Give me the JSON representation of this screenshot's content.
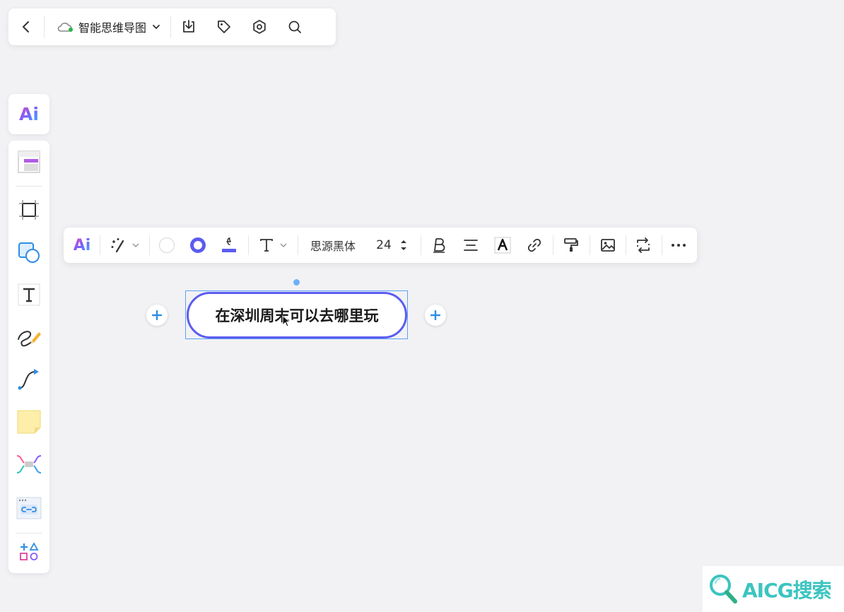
{
  "topbar": {
    "title": "智能思维导图",
    "icons": [
      "back-icon",
      "cloud-sync-icon",
      "chevron-down-icon",
      "download-icon",
      "tag-icon",
      "settings-icon",
      "search-icon"
    ]
  },
  "sidebar": {
    "ai_label": "Ai",
    "tools": [
      "template-icon",
      "frame-icon",
      "shape-icon",
      "text-tool-icon",
      "pen-icon",
      "connector-icon",
      "sticky-note-icon",
      "mindmap-icon",
      "link-card-icon",
      "more-shapes-icon"
    ]
  },
  "format_toolbar": {
    "ai_label": "Ai",
    "font_name": "思源黑体",
    "font_size": "24",
    "colors": {
      "fill": "#ffffff",
      "border": "#5b5cf0",
      "line": "#5b5cf0"
    }
  },
  "canvas": {
    "node_text": "在深圳周末可以去哪里玩",
    "node_border_color": "#5b5cf0"
  },
  "watermark": {
    "text": "AICG搜索"
  }
}
